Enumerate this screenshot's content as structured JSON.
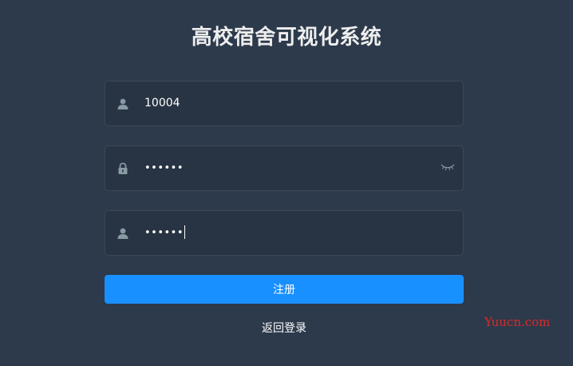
{
  "title": "高校宿舍可视化系统",
  "fields": {
    "username": {
      "value": "10004",
      "icon": "user-icon"
    },
    "password": {
      "value": "••••••",
      "icon": "lock-icon",
      "toggle_icon": "eye-closed-icon"
    },
    "confirm": {
      "value": "••••••",
      "icon": "user-icon"
    }
  },
  "actions": {
    "register_label": "注册",
    "back_label": "返回登录"
  },
  "watermark": "Yuucn.com",
  "colors": {
    "background": "#2d3a4b",
    "input_background": "#283443",
    "primary": "#1890ff",
    "icon": "#889aa4",
    "watermark": "#d92a2a"
  }
}
